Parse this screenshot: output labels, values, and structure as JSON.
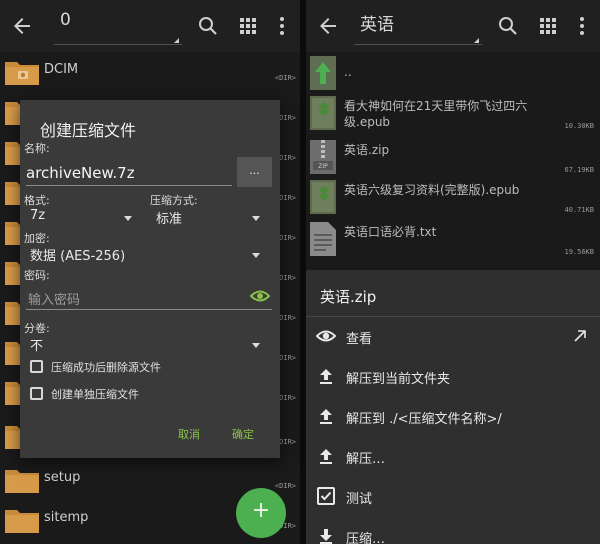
{
  "left": {
    "appbar": {
      "title": "0"
    },
    "folders": [
      {
        "name": "DCIM",
        "tag": "<DIR>"
      },
      {
        "name": "",
        "tag": "<DIR>"
      },
      {
        "name": "",
        "tag": "<DIR>"
      },
      {
        "name": "",
        "tag": "<DIR>"
      },
      {
        "name": "",
        "tag": "<DIR>"
      },
      {
        "name": "",
        "tag": "<DIR>"
      },
      {
        "name": "",
        "tag": "<DIR>"
      },
      {
        "name": "",
        "tag": "<DIR>"
      },
      {
        "name": "",
        "tag": "<DIR>"
      },
      {
        "name": "",
        "tag": "<DIR>"
      },
      {
        "name": "setup",
        "tag": "<DIR>"
      },
      {
        "name": "sitemp",
        "tag": "<DIR>"
      }
    ],
    "dialog": {
      "title": "创建压缩文件",
      "name_label": "名称:",
      "name_value": "archiveNew.7z",
      "browse_label": "...",
      "format_label": "格式:",
      "format_value": "7z",
      "method_label": "压缩方式:",
      "method_value": "标准",
      "encrypt_label": "加密:",
      "encrypt_value": "数据 (AES-256)",
      "password_label": "密码:",
      "password_placeholder": "输入密码",
      "split_label": "分卷:",
      "split_value": "不",
      "delete_source_label": "压缩成功后删除源文件",
      "separate_archives_label": "创建单独压缩文件",
      "cancel_label": "取消",
      "ok_label": "确定"
    },
    "fab_label": "+"
  },
  "right": {
    "appbar": {
      "title": "英语"
    },
    "files": [
      {
        "name": "..",
        "size": "",
        "kind": "up"
      },
      {
        "name": "看大神如何在21天里带你飞过四六级.epub",
        "size": "10.30KB",
        "kind": "epub"
      },
      {
        "name": "英语.zip",
        "size": "67.19KB",
        "kind": "zip"
      },
      {
        "name": "英语六级复习资料(完整版).epub",
        "size": "40.71KB",
        "kind": "epub"
      },
      {
        "name": "英语口语必背.txt",
        "size": "19.56KB",
        "kind": "txt"
      }
    ],
    "sheet": {
      "title": "英语.zip",
      "items": [
        {
          "label": "查看",
          "icon": "eye-icon"
        },
        {
          "label": "解压到当前文件夹",
          "icon": "upload-icon"
        },
        {
          "label": "解压到 ./<压缩文件名称>/",
          "icon": "upload-icon"
        },
        {
          "label": "解压…",
          "icon": "upload-icon"
        },
        {
          "label": "测试",
          "icon": "checkbox-icon"
        },
        {
          "label": "压缩…",
          "icon": "download-icon"
        }
      ]
    }
  },
  "colors": {
    "accent": "#8bc34a",
    "fab": "#4caf50",
    "folder": "#c98a3a",
    "dialog_bg": "#3a3a3a",
    "sheet_bg": "#2f2f2f"
  }
}
